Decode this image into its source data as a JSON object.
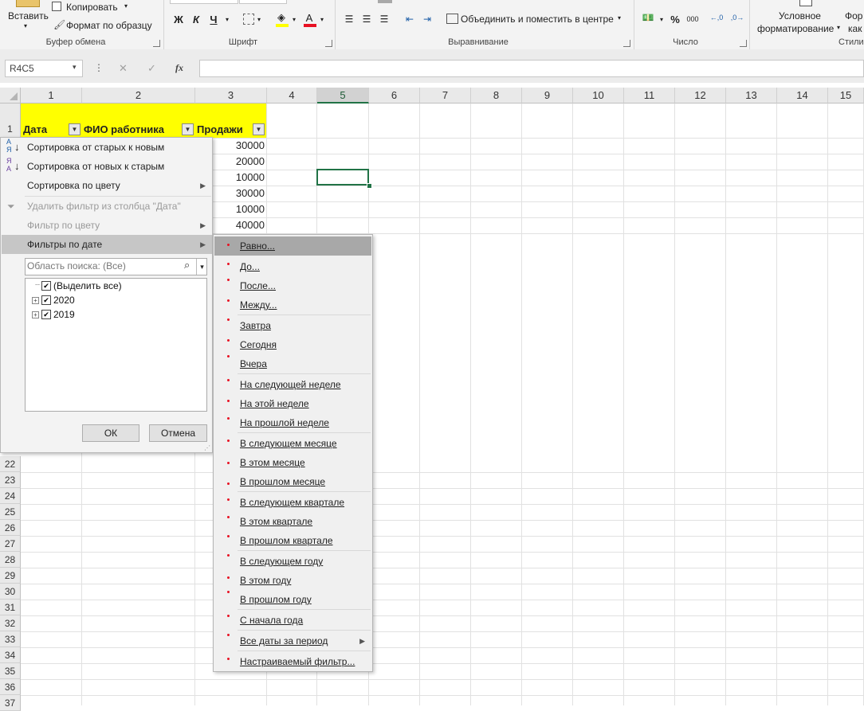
{
  "ribbon": {
    "paste_label": "Вставить",
    "copy_label": "Копировать",
    "format_painter_label": "Формат по образцу",
    "clipboard_group": "Буфер обмена",
    "font_group": "Шрифт",
    "bold": "Ж",
    "italic": "К",
    "underline": "Ч",
    "font_color_letter": "А",
    "alignment_group": "Выравнивание",
    "merge_label": "Объединить и поместить в центре",
    "number_group": "Число",
    "percent": "%",
    "thousands": "000",
    "cond_format_line1": "Условное",
    "cond_format_line2": "форматирование",
    "format_as_table_line1": "Фор",
    "format_as_table_line2": "как",
    "styles_group": "Стили",
    "accent_color": "#217346"
  },
  "formula_bar": {
    "name_box": "R4C5",
    "fx": "fx",
    "cancel": "✕",
    "enter": "✓"
  },
  "sheet": {
    "columns": [
      "1",
      "2",
      "3",
      "4",
      "5",
      "6",
      "7",
      "8",
      "9",
      "10",
      "11",
      "12",
      "13",
      "14",
      "15"
    ],
    "selected_column": "5",
    "rows_top": [
      "1"
    ],
    "rows_bottom": [
      "22",
      "23",
      "24",
      "25",
      "26",
      "27",
      "28",
      "29",
      "30",
      "31",
      "32",
      "33",
      "34",
      "35",
      "36",
      "37"
    ],
    "headers": [
      "Дата",
      "ФИО работника",
      "Продажи"
    ],
    "sales": [
      "30000",
      "20000",
      "10000",
      "30000",
      "10000",
      "40000"
    ],
    "header_fill": "#ffff00"
  },
  "filter_menu": {
    "sort_old_new": "Сортировка от старых к новым",
    "sort_new_old": "Сортировка от новых к старым",
    "sort_by_color": "Сортировка по цвету",
    "clear_filter": "Удалить фильтр из столбца \"Дата\"",
    "filter_by_color": "Фильтр по цвету",
    "date_filters": "Фильтры по дате",
    "search_placeholder": "Область поиска: (Все)",
    "tree": {
      "select_all": "(Выделить все)",
      "year_1": "2020",
      "year_2": "2019"
    },
    "ok": "ОК",
    "cancel": "Отмена"
  },
  "date_submenu": {
    "items": [
      "Равно...",
      "До...",
      "После...",
      "Между...",
      "Завтра",
      "Сегодня",
      "Вчера",
      "На следующей неделе",
      "На этой неделе",
      "На прошлой неделе",
      "В следующем месяце",
      "В этом месяце",
      "В прошлом месяце",
      "В следующем квартале",
      "В этом квартале",
      "В прошлом квартале",
      "В следующем году",
      "В этом году",
      "В прошлом году",
      "С начала года",
      "Все даты за период",
      "Настраиваемый фильтр..."
    ]
  }
}
